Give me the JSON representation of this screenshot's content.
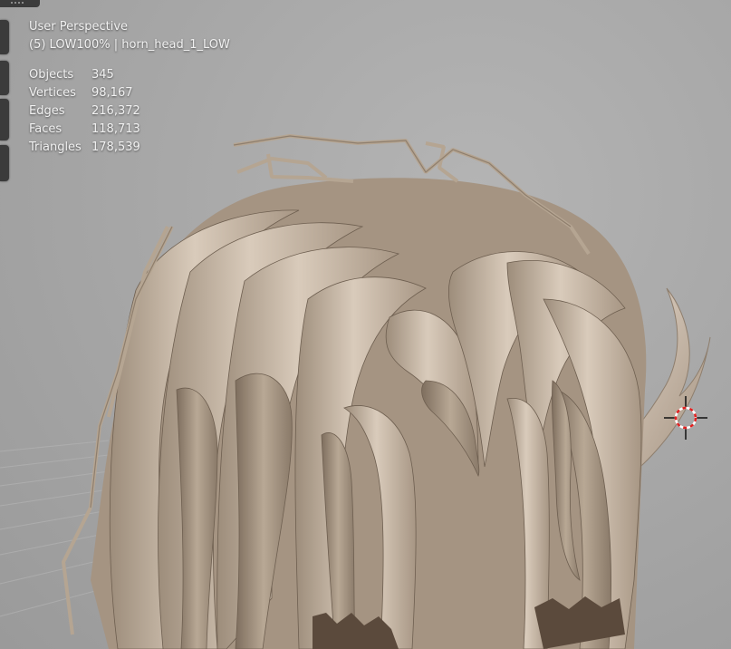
{
  "viewport": {
    "view_name": "User Perspective",
    "collection_info": "(5) LOW100% | horn_head_1_LOW"
  },
  "statistics": [
    {
      "label": "Objects",
      "value": "345"
    },
    {
      "label": "Vertices",
      "value": "98,167"
    },
    {
      "label": "Edges",
      "value": "216,372"
    },
    {
      "label": "Faces",
      "value": "118,713"
    },
    {
      "label": "Triangles",
      "value": "178,539"
    }
  ],
  "colors": {
    "background": "#a8a8a8",
    "hair": "#c7b8a6",
    "hair_shadow": "#8e7e6d",
    "skin": "#9b55b0",
    "overlay_text": "#f1f1f1"
  },
  "icons": {
    "cursor": "3d-cursor-icon"
  }
}
